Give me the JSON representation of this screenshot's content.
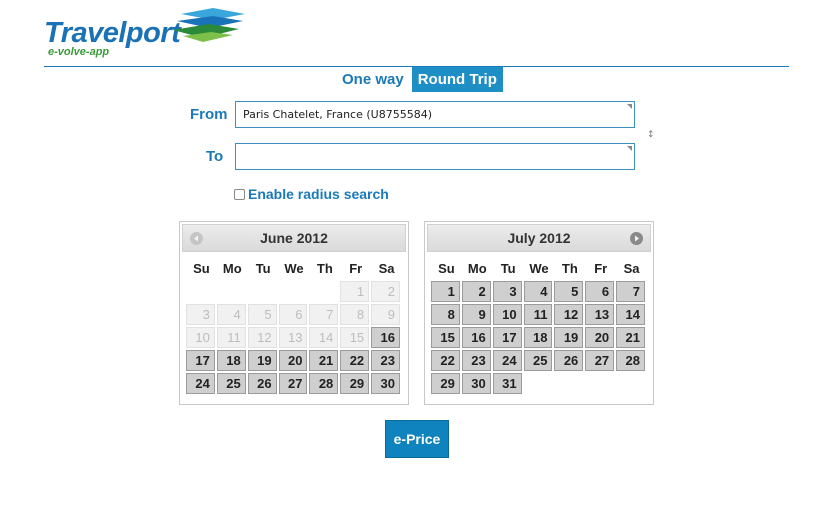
{
  "logo": {
    "brand": "Travelport",
    "subtitle": "e-volve-app"
  },
  "trip_type": {
    "options": [
      "One way",
      "Round Trip"
    ],
    "selected": "Round Trip"
  },
  "form": {
    "from_label": "From",
    "from_value": "Paris Chatelet, France (U8755584)",
    "to_label": "To",
    "to_value": "",
    "radius_label": "Enable radius search",
    "radius_checked": false
  },
  "calendars": [
    {
      "title": "June 2012",
      "nav": "prev-icon",
      "days_of_week": [
        "Su",
        "Mo",
        "Tu",
        "We",
        "Th",
        "Fr",
        "Sa"
      ],
      "weeks": [
        [
          null,
          null,
          null,
          null,
          null,
          {
            "d": "1",
            "s": "disabled"
          },
          {
            "d": "2",
            "s": "disabled"
          }
        ],
        [
          {
            "d": "3",
            "s": "disabled"
          },
          {
            "d": "4",
            "s": "disabled"
          },
          {
            "d": "5",
            "s": "disabled"
          },
          {
            "d": "6",
            "s": "disabled"
          },
          {
            "d": "7",
            "s": "disabled"
          },
          {
            "d": "8",
            "s": "disabled"
          },
          {
            "d": "9",
            "s": "disabled"
          }
        ],
        [
          {
            "d": "10",
            "s": "disabled"
          },
          {
            "d": "11",
            "s": "disabled"
          },
          {
            "d": "12",
            "s": "disabled"
          },
          {
            "d": "13",
            "s": "disabled"
          },
          {
            "d": "14",
            "s": "disabled"
          },
          {
            "d": "15",
            "s": "disabled"
          },
          {
            "d": "16",
            "s": "enabled"
          }
        ],
        [
          {
            "d": "17",
            "s": "enabled"
          },
          {
            "d": "18",
            "s": "enabled"
          },
          {
            "d": "19",
            "s": "enabled"
          },
          {
            "d": "20",
            "s": "enabled"
          },
          {
            "d": "21",
            "s": "enabled"
          },
          {
            "d": "22",
            "s": "enabled"
          },
          {
            "d": "23",
            "s": "enabled"
          }
        ],
        [
          {
            "d": "24",
            "s": "enabled"
          },
          {
            "d": "25",
            "s": "enabled"
          },
          {
            "d": "26",
            "s": "enabled"
          },
          {
            "d": "27",
            "s": "enabled"
          },
          {
            "d": "28",
            "s": "enabled"
          },
          {
            "d": "29",
            "s": "enabled"
          },
          {
            "d": "30",
            "s": "enabled"
          }
        ]
      ]
    },
    {
      "title": "July 2012",
      "nav": "next-icon",
      "days_of_week": [
        "Su",
        "Mo",
        "Tu",
        "We",
        "Th",
        "Fr",
        "Sa"
      ],
      "weeks": [
        [
          {
            "d": "1",
            "s": "enabled"
          },
          {
            "d": "2",
            "s": "enabled"
          },
          {
            "d": "3",
            "s": "enabled"
          },
          {
            "d": "4",
            "s": "enabled"
          },
          {
            "d": "5",
            "s": "enabled"
          },
          {
            "d": "6",
            "s": "enabled"
          },
          {
            "d": "7",
            "s": "enabled"
          }
        ],
        [
          {
            "d": "8",
            "s": "enabled"
          },
          {
            "d": "9",
            "s": "enabled"
          },
          {
            "d": "10",
            "s": "enabled"
          },
          {
            "d": "11",
            "s": "enabled"
          },
          {
            "d": "12",
            "s": "enabled"
          },
          {
            "d": "13",
            "s": "enabled"
          },
          {
            "d": "14",
            "s": "enabled"
          }
        ],
        [
          {
            "d": "15",
            "s": "enabled"
          },
          {
            "d": "16",
            "s": "enabled"
          },
          {
            "d": "17",
            "s": "enabled"
          },
          {
            "d": "18",
            "s": "enabled"
          },
          {
            "d": "19",
            "s": "enabled"
          },
          {
            "d": "20",
            "s": "enabled"
          },
          {
            "d": "21",
            "s": "enabled"
          }
        ],
        [
          {
            "d": "22",
            "s": "enabled"
          },
          {
            "d": "23",
            "s": "enabled"
          },
          {
            "d": "24",
            "s": "enabled"
          },
          {
            "d": "25",
            "s": "enabled"
          },
          {
            "d": "26",
            "s": "enabled"
          },
          {
            "d": "27",
            "s": "enabled"
          },
          {
            "d": "28",
            "s": "enabled"
          }
        ],
        [
          {
            "d": "29",
            "s": "enabled"
          },
          {
            "d": "30",
            "s": "enabled"
          },
          {
            "d": "31",
            "s": "enabled"
          },
          null,
          null,
          null,
          null
        ]
      ]
    }
  ],
  "submit_label": "e-Price",
  "colors": {
    "brand_blue": "#1a7ab8",
    "button_blue": "#0e83bd",
    "logo_green": "#3a9a3a"
  }
}
